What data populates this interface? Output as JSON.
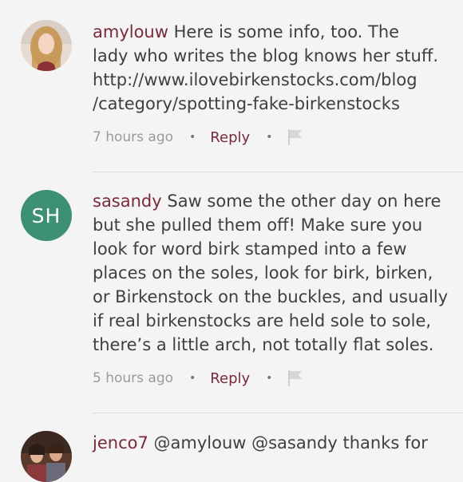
{
  "comments": [
    {
      "username": "amylouw",
      "lines": [
        "Here is some info, too. The",
        "lady who writes the blog knows her stuff.",
        "http://www.ilovebirkenstocks.com/blog",
        "/category/spotting-fake-birkenstocks"
      ],
      "time": "7 hours ago",
      "reply_label": "Reply",
      "avatar": "photo"
    },
    {
      "username": "sasandy",
      "initials": "SH",
      "lines": [
        "Saw some the other day on here",
        "but she pulled them off! Make sure you",
        "look for word birk stamped into a few",
        "places on the soles, look for birk, birken,",
        "or Birkenstock on the buckles, and usually",
        "if real birkenstocks are held sole to sole,",
        "there’s a little arch, not totally flat soles."
      ],
      "time": "5 hours ago",
      "reply_label": "Reply",
      "avatar_color": "#3d9071"
    },
    {
      "username": "jenco7",
      "lines": [
        "@amylouw @sasandy thanks for"
      ],
      "avatar": "photo"
    }
  ],
  "separator": "•",
  "colors": {
    "username": "#7a2a3a",
    "reply": "#7a2a3a",
    "meta": "#9a9a9a",
    "background": "#f4f4f4"
  },
  "icons": {
    "flag": "flag-icon"
  }
}
